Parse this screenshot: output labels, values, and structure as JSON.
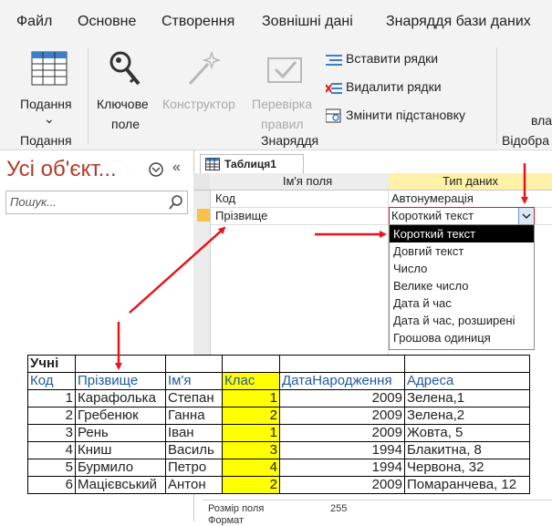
{
  "menu": [
    "Файл",
    "Основне",
    "Створення",
    "Зовнішні дані",
    "Знаряддя бази даних"
  ],
  "ribbon": {
    "view_label_1": "Подання",
    "view_group": "Подання",
    "key_label_1": "Ключове",
    "key_label_2": "поле",
    "builder_label": "Конструктор",
    "check_label_1": "Перевірка",
    "check_label_2": "правил",
    "insert_rows": "Вставити рядки",
    "delete_rows": "Видалити рядки",
    "modify_lookups": "Змінити підстановку",
    "tools_group": "Знаряддя",
    "show_group": "Відобра",
    "cut_text": "вла"
  },
  "nav": {
    "title": "Усі об'єкт...",
    "search_placeholder": "Пошук..."
  },
  "design": {
    "tab_label": "Таблиця1",
    "col_field": "Ім'я поля",
    "col_type": "Тип даних",
    "rows": [
      {
        "field": "Код",
        "type": "Автонумерація"
      },
      {
        "field": "Прізвище",
        "type": "Короткий текст"
      }
    ],
    "dropdown": [
      "Короткий текст",
      "Довгий текст",
      "Число",
      "Велике число",
      "Дата й час",
      "Дата й час, розширені",
      "Грошова одиниця"
    ],
    "prop_label": "Розмір поля",
    "prop_value": "255",
    "prop_next": "Формат"
  },
  "overlay": {
    "title": "Учні",
    "headers": [
      "Код",
      "Прізвище",
      "Ім'я",
      "Клас",
      "ДатаНародження",
      "Адреса"
    ],
    "rows": [
      [
        "1",
        "Карафолька",
        "Степан",
        "1",
        "2009",
        "Зелена,1"
      ],
      [
        "2",
        "Гребенюк",
        "Ганна",
        "2",
        "2009",
        "Зелена,2"
      ],
      [
        "3",
        "Рень",
        "Іван",
        "1",
        "2009",
        "Жовта, 5"
      ],
      [
        "4",
        "Книш",
        "Василь",
        "3",
        "1994",
        "Блакитна, 8"
      ],
      [
        "5",
        "Бурмило",
        "Петро",
        "4",
        "1994",
        "Червона, 32"
      ],
      [
        "6",
        "Мацієвський",
        "Антон",
        "2",
        "2009",
        "Помаранчева, 12"
      ]
    ]
  },
  "colors": {
    "arrow": "#e8141c",
    "highlight": "#ffff00",
    "accent": "#b23a2a"
  }
}
